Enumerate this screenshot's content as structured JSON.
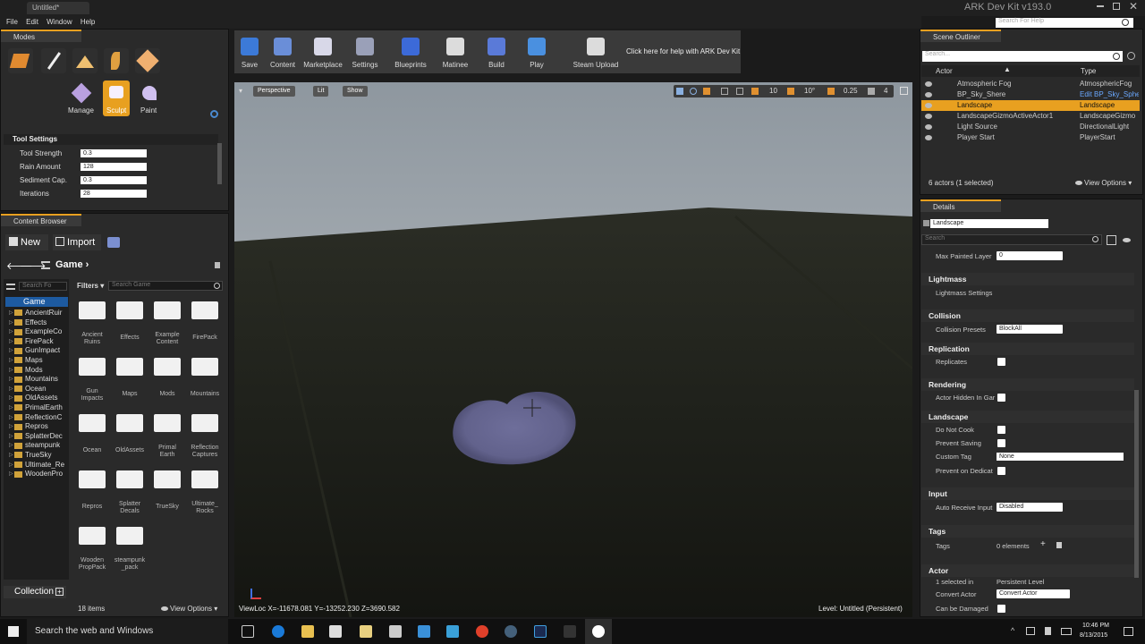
{
  "window": {
    "tab_title": "Untitled*",
    "app_title": "ARK Dev Kit v193.0",
    "help_search_placeholder": "Search For Help"
  },
  "menu": [
    "File",
    "Edit",
    "Window",
    "Help"
  ],
  "modes": {
    "panel_title": "Modes",
    "tools": [
      "Manage",
      "Sculpt",
      "Paint"
    ]
  },
  "tool_settings": {
    "header": "Tool Settings",
    "props": [
      {
        "label": "Tool Strength",
        "value": "0.3"
      },
      {
        "label": "Rain Amount",
        "value": "128"
      },
      {
        "label": "Sediment Cap.",
        "value": "0.3"
      },
      {
        "label": "Iterations",
        "value": "28"
      }
    ]
  },
  "toolbar": {
    "buttons": [
      "Save",
      "Content",
      "Marketplace",
      "Settings",
      "Blueprints",
      "Matinee",
      "Build",
      "Play",
      "Steam Upload"
    ],
    "help_text": "Click here for help with ARK Dev Kit"
  },
  "viewport": {
    "perspective": "Perspective",
    "lit": "Lit",
    "show": "Show",
    "snap_grid": "10",
    "snap_rot": "10°",
    "snap_scale": "0.25",
    "cam_speed": "4",
    "view_loc": "ViewLoc X=-11678.081 Y=-13252.230 Z=3690.582",
    "level": "Level:  Untitled (Persistent)"
  },
  "content_browser": {
    "panel_title": "Content Browser",
    "new_label": "New",
    "import_label": "Import",
    "path": "Game",
    "filters_label": "Filters",
    "search_folders_placeholder": "Search Fo",
    "search_game_placeholder": "Search Game",
    "tree_root": "Game",
    "tree": [
      "AncientRuir",
      "Effects",
      "ExampleCo",
      "FirePack",
      "GunImpact",
      "Maps",
      "Mods",
      "Mountains",
      "Ocean",
      "OldAssets",
      "PrimalEarth",
      "ReflectionC",
      "Repros",
      "SplatterDec",
      "steampunk",
      "TrueSky",
      "Ultimate_Re",
      "WoodenPro"
    ],
    "folders": [
      [
        "Ancient",
        "Ruins"
      ],
      [
        "Effects"
      ],
      [
        "Example",
        "Content"
      ],
      [
        "FirePack"
      ],
      [
        "Gun",
        "Impacts"
      ],
      [
        "Maps"
      ],
      [
        "Mods"
      ],
      [
        "Mountains"
      ],
      [
        "Ocean"
      ],
      [
        "OldAssets"
      ],
      [
        "Primal",
        "Earth"
      ],
      [
        "Reflection",
        "Captures"
      ],
      [
        "Repros"
      ],
      [
        "Splatter",
        "Decals"
      ],
      [
        "TrueSky"
      ],
      [
        "Ultimate_",
        "Rocks"
      ],
      [
        "Wooden",
        "PropPack"
      ],
      [
        "steampunk",
        "_pack"
      ]
    ],
    "item_count": "18 items",
    "view_options": "View Options",
    "collections": "Collection"
  },
  "scene_outliner": {
    "panel_title": "Scene Outliner",
    "search_placeholder": "Search...",
    "col_actor": "Actor",
    "col_type": "Type",
    "rows": [
      {
        "name": "Atmospheric Fog",
        "type": "AtmosphericFog"
      },
      {
        "name": "BP_Sky_Shere",
        "type": "Edit BP_Sky_Sphe"
      },
      {
        "name": "Landscape",
        "type": "Landscape"
      },
      {
        "name": "LandscapeGizmoActiveActor1",
        "type": "LandscapeGizmo"
      },
      {
        "name": "Light Source",
        "type": "DirectionalLight"
      },
      {
        "name": "Player Start",
        "type": "PlayerStart"
      }
    ],
    "status": "6 actors (1 selected)",
    "view_options": "View Options"
  },
  "details": {
    "panel_title": "Details",
    "name_value": "Landscape",
    "search_placeholder": "Search",
    "max_painted_layer_label": "Max Painted Layer",
    "max_painted_layer_value": "0",
    "sections": {
      "lightmass": "Lightmass",
      "collision": "Collision",
      "replication": "Replication",
      "rendering": "Rendering",
      "landscape": "Landscape",
      "input": "Input",
      "tags": "Tags",
      "actor": "Actor"
    },
    "lightmass_settings": "Lightmass Settings",
    "collision_presets": "Collision Presets",
    "collision_value": "BlockAll",
    "replicates": "Replicates",
    "actor_hidden": "Actor Hidden In Gar",
    "do_not_cook": "Do Not Cook",
    "prevent_saving": "Prevent Saving",
    "custom_tag": "Custom Tag",
    "custom_tag_value": "None",
    "prevent_on_dedicat": "Prevent on Dedicat",
    "auto_receive": "Auto Receive Input",
    "auto_receive_value": "Disabled",
    "tags_label": "Tags",
    "tags_value": "0 elements",
    "selected_in": "1 selected in",
    "selected_in_value": "Persistent Level",
    "convert_actor": "Convert Actor",
    "convert_actor_value": "Convert Actor",
    "can_be_damaged": "Can be Damaged"
  },
  "taskbar": {
    "search": "Search the web and Windows",
    "time": "10:46 PM",
    "date": "8/13/2015"
  }
}
